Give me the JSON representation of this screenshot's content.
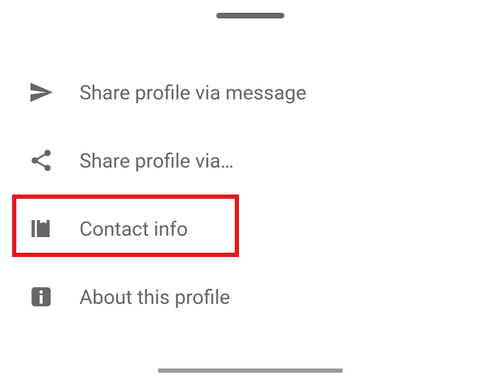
{
  "menu": {
    "items": [
      {
        "label": "Share profile via message",
        "icon": "send-icon"
      },
      {
        "label": "Share profile via…",
        "icon": "share-icon"
      },
      {
        "label": "Contact info",
        "icon": "contact-icon",
        "highlighted": true
      },
      {
        "label": "About this profile",
        "icon": "info-icon"
      }
    ]
  }
}
